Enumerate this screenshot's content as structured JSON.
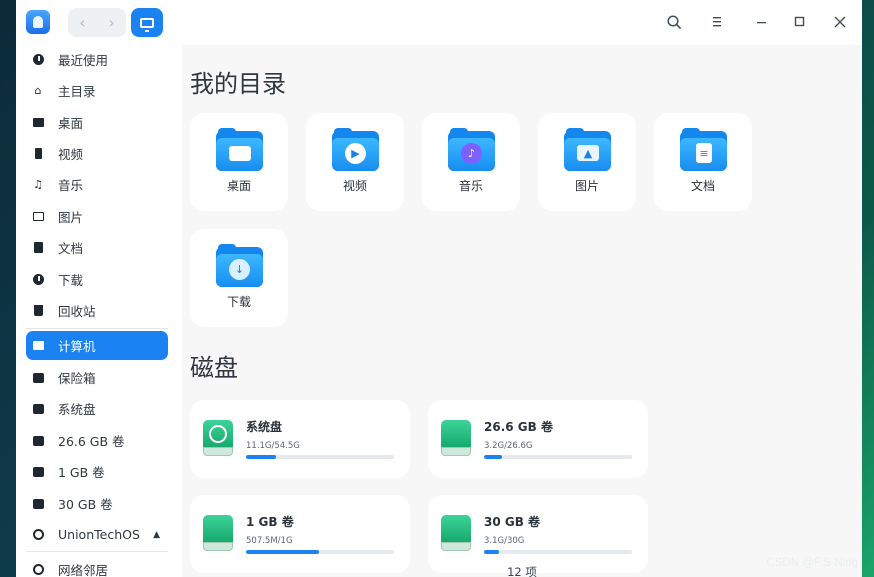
{
  "window": {
    "title_buttons": {
      "search_icon": "search-icon",
      "menu_icon": "menu-icon",
      "minimize_icon": "minimize-icon",
      "maximize_icon": "maximize-icon",
      "close_icon": "close-icon"
    },
    "nav": {
      "back": "‹",
      "forward": "›"
    }
  },
  "sidebar": {
    "items": [
      {
        "label": "最近使用",
        "icon": "clock-icon"
      },
      {
        "label": "主目录",
        "icon": "home-icon"
      },
      {
        "label": "桌面",
        "icon": "desktop-icon"
      },
      {
        "label": "视频",
        "icon": "video-icon"
      },
      {
        "label": "音乐",
        "icon": "music-icon"
      },
      {
        "label": "图片",
        "icon": "image-icon"
      },
      {
        "label": "文档",
        "icon": "document-icon"
      },
      {
        "label": "下载",
        "icon": "download-icon"
      },
      {
        "label": "回收站",
        "icon": "trash-icon"
      },
      {
        "label": "计算机",
        "icon": "computer-icon",
        "active": true
      },
      {
        "label": "保险箱",
        "icon": "vault-icon"
      },
      {
        "label": "系统盘",
        "icon": "system-disk-icon"
      },
      {
        "label": "26.6 GB 卷",
        "icon": "disk-icon"
      },
      {
        "label": "1 GB 卷",
        "icon": "disk-icon"
      },
      {
        "label": "30 GB 卷",
        "icon": "disk-icon"
      },
      {
        "label": "UnionTechOS",
        "icon": "optical-disk-icon"
      },
      {
        "label": "网络邻居",
        "icon": "network-icon"
      }
    ]
  },
  "main": {
    "my_directory_title": "我的目录",
    "folders": [
      {
        "label": "桌面",
        "icon": "desktop-folder-icon"
      },
      {
        "label": "视频",
        "icon": "video-folder-icon"
      },
      {
        "label": "音乐",
        "icon": "music-folder-icon"
      },
      {
        "label": "图片",
        "icon": "pictures-folder-icon"
      },
      {
        "label": "文档",
        "icon": "documents-folder-icon"
      },
      {
        "label": "下载",
        "icon": "download-folder-icon"
      }
    ],
    "disks_title": "磁盘",
    "disks": [
      {
        "name": "系统盘",
        "usage": "11.1G/54.5G",
        "fraction": 0.204
      },
      {
        "name": "26.6 GB 卷",
        "usage": "3.2G/26.6G",
        "fraction": 0.12
      },
      {
        "name": "1 GB 卷",
        "usage": "507.5M/1G",
        "fraction": 0.496
      },
      {
        "name": "30 GB 卷",
        "usage": "3.1G/30G",
        "fraction": 0.103
      }
    ],
    "status": "12 项"
  },
  "watermark": "CSDN @F.S-Ning",
  "colors": {
    "accent": "#1b82f2",
    "disk_green": "#15a86a"
  }
}
